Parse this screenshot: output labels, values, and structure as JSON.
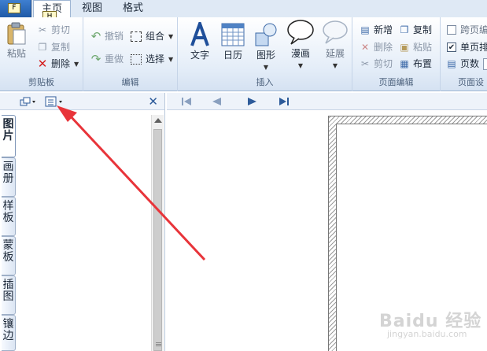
{
  "tabs": {
    "app_key": "F",
    "home": "主页",
    "home_key": "H",
    "view": "视图",
    "format": "格式"
  },
  "ribbon": {
    "clipboard": {
      "label": "剪贴板",
      "paste": "粘贴",
      "cut": "剪切",
      "copy": "复制",
      "delete": "删除"
    },
    "edit": {
      "label": "编辑",
      "undo": "撤销",
      "redo": "重做",
      "group": "组合",
      "select": "选择"
    },
    "insert": {
      "label": "插入",
      "text": "文字",
      "calendar": "日历",
      "shape": "图形",
      "comic": "漫画",
      "extend": "延展"
    },
    "page_edit": {
      "label": "页面编辑",
      "new": "新增",
      "copy": "复制",
      "delete": "删除",
      "paste": "粘贴",
      "cut": "剪切",
      "layout": "布置"
    },
    "page_settings": {
      "label": "页面设",
      "spread": "跨页编",
      "single": "单页排",
      "page_count": "页数",
      "single_checked": true
    }
  },
  "panel": {
    "close": "✕",
    "vtabs": [
      {
        "label": "图片",
        "active": true
      },
      {
        "label": "画册",
        "active": false
      },
      {
        "label": "样板",
        "active": false
      },
      {
        "label": "蒙板",
        "active": false
      },
      {
        "label": "插图",
        "active": false
      },
      {
        "label": "镶边",
        "active": false
      }
    ]
  },
  "watermark": {
    "brand": "Baidu 经验",
    "site": "jingyan.baidu.com"
  },
  "colors": {
    "accent": "#1f5aa8",
    "arrow": "#e8343a",
    "ribbon_bg": "#e4edf8"
  }
}
